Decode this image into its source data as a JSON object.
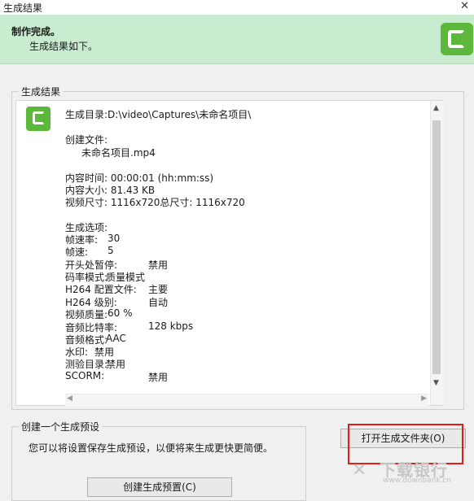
{
  "window": {
    "title": "生成结果",
    "close_icon": "✕"
  },
  "banner": {
    "title": "制作完成。",
    "subtitle": "生成结果如下。",
    "logo_icon": "camtasia-logo"
  },
  "results": {
    "group_label": "生成结果",
    "output_dir": "生成目录:D:\\video\\Captures\\未命名项目\\",
    "created_files_label": "创建文件:",
    "created_file": "未命名项目.mp4",
    "duration": "内容时间:  00:00:01 (hh:mm:ss)",
    "size": "内容大小:  81.43 KB",
    "dimensions": "视频尺寸:  1116x720总尺寸:     1116x720",
    "options_label": "生成选项:",
    "options": [
      {
        "label": "帧速率:",
        "value": "30"
      },
      {
        "label": "帧速:",
        "value": "5"
      },
      {
        "label": "开头处暂停:",
        "value": "禁用"
      },
      {
        "label": "码率模式:",
        "value": "质量模式"
      },
      {
        "label": "H264 配置文件:",
        "value": "主要"
      },
      {
        "label": "H264 级别:",
        "value": "自动"
      },
      {
        "label": "视频质量:",
        "value": "60 %"
      },
      {
        "label": "音频比特率:",
        "value": "128 kbps"
      },
      {
        "label": "音频格式:",
        "value": "AAC"
      },
      {
        "label": "水印:",
        "value": "禁用"
      },
      {
        "label": "测验目录:",
        "value": "禁用"
      },
      {
        "label": "SCORM:",
        "value": "禁用"
      }
    ]
  },
  "preset": {
    "group_label": "创建一个生成预设",
    "description": "您可以将设置保存生成预设，以便将来生成更快更简便。",
    "create_button": "创建生成预置(C)"
  },
  "open_folder_button": "打开生成文件夹(O)",
  "watermark": {
    "logo": "✕",
    "text": "下载银行",
    "url": "www.downbank.cn"
  }
}
